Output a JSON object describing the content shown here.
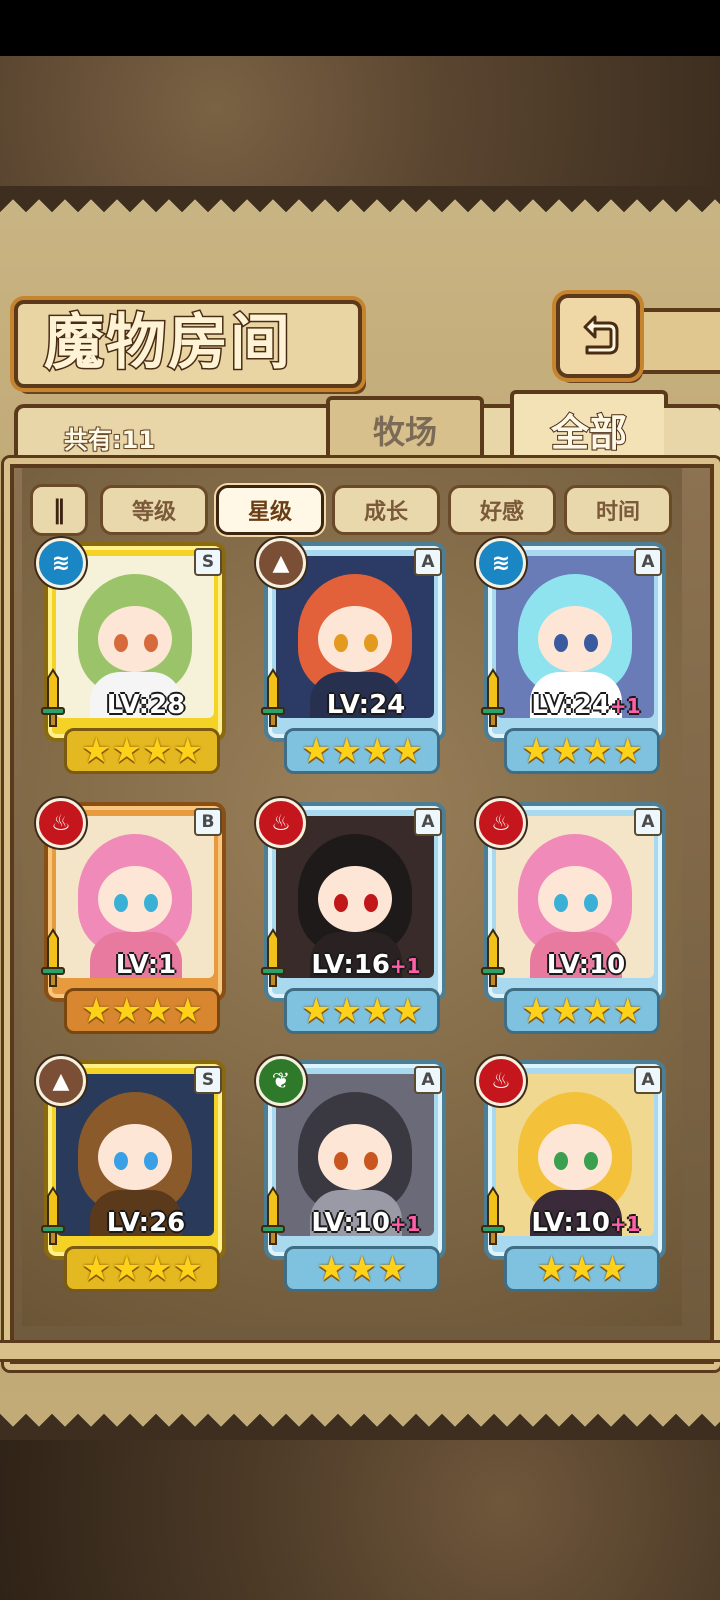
{
  "title": "魔物房间",
  "count_label": "共有:11",
  "tabs": {
    "farm": "牧场",
    "all": "全部"
  },
  "sort_icon": "‖",
  "filters": [
    "等级",
    "星级",
    "成长",
    "好感",
    "时间"
  ],
  "active_filter": "星级",
  "monsters": [
    {
      "rank": "S",
      "element": "water",
      "level": "LV:28",
      "plus": "",
      "stars": "★★★★",
      "frame": "gold"
    },
    {
      "rank": "A",
      "element": "earth",
      "level": "LV:24",
      "plus": "",
      "stars": "★★★★",
      "frame": "blue"
    },
    {
      "rank": "A",
      "element": "water",
      "level": "LV:24",
      "plus": "+1",
      "stars": "★★★★",
      "frame": "blue"
    },
    {
      "rank": "B",
      "element": "fire",
      "level": "LV:1",
      "plus": "",
      "stars": "★★★★",
      "frame": "orange"
    },
    {
      "rank": "A",
      "element": "fire",
      "level": "LV:16",
      "plus": "+1",
      "stars": "★★★★",
      "frame": "blue"
    },
    {
      "rank": "A",
      "element": "fire",
      "level": "LV:10",
      "plus": "",
      "stars": "★★★★",
      "frame": "blue"
    },
    {
      "rank": "S",
      "element": "earth",
      "level": "LV:26",
      "plus": "",
      "stars": "★★★★",
      "frame": "gold"
    },
    {
      "rank": "A",
      "element": "wood",
      "level": "LV:10",
      "plus": "+1",
      "stars": "★★★",
      "frame": "blue"
    },
    {
      "rank": "A",
      "element": "fire",
      "level": "LV:10",
      "plus": "+1",
      "stars": "★★★",
      "frame": "blue"
    }
  ],
  "colors": {
    "gold_frame": "#f4d326",
    "blue_frame": "#a9d9ef",
    "orange_frame": "#e89a3e",
    "water": "#1b86c4",
    "earth": "#7a4f35",
    "fire": "#c4161c",
    "wood": "#2f7a2a"
  }
}
